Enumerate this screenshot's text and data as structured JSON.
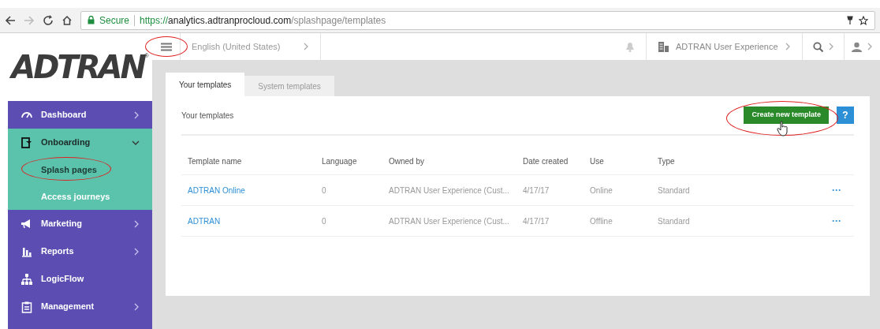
{
  "browser": {
    "back_disabled": false,
    "forward_disabled": true,
    "secure_label": "Secure",
    "url": {
      "scheme": "https://",
      "host": "analytics.adtranprocloud.com",
      "path": "/splashpage/templates"
    }
  },
  "logo": {
    "text": "ADTRAN",
    "mark": "®"
  },
  "topbar": {
    "language": "English (United States)",
    "account": "ADTRAN User Experience"
  },
  "sidebar": {
    "items": [
      {
        "label": "Dashboard",
        "expanded": false
      },
      {
        "label": "Onboarding",
        "expanded": true,
        "children": [
          {
            "label": "Splash pages",
            "selected": true
          },
          {
            "label": "Access journeys",
            "selected": false
          }
        ]
      },
      {
        "label": "Marketing",
        "expanded": false
      },
      {
        "label": "Reports",
        "expanded": false
      },
      {
        "label": "LogicFlow"
      },
      {
        "label": "Management",
        "expanded": false
      }
    ]
  },
  "tabs": [
    {
      "label": "Your templates",
      "selected": true
    },
    {
      "label": "System templates",
      "selected": false
    }
  ],
  "card": {
    "title": "Your templates",
    "create_button": "Create new template",
    "help": "?"
  },
  "table": {
    "columns": [
      "Template name",
      "Language",
      "Owned by",
      "Date created",
      "Use",
      "Type"
    ],
    "rows": [
      {
        "cells": [
          "ADTRAN Online",
          "0",
          "ADTRAN User Experience (Cust...",
          "4/17/17",
          "Online",
          "Standard"
        ],
        "actions": "···"
      },
      {
        "cells": [
          "ADTRAN",
          "0",
          "ADTRAN User Experience (Cust...",
          "4/17/17",
          "Offline",
          "Standard"
        ],
        "actions": "···"
      }
    ]
  }
}
